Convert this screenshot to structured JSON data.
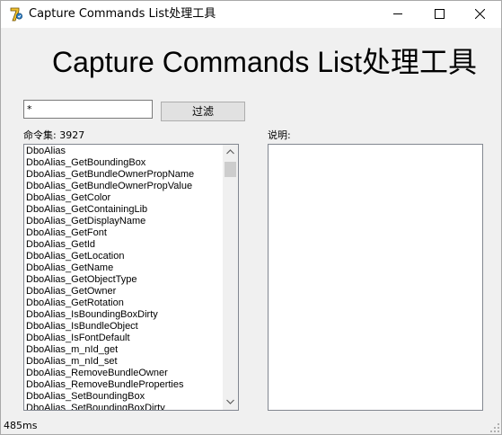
{
  "window": {
    "title": "Capture Commands List处理工具"
  },
  "header": {
    "title": "Capture Commands List处理工具"
  },
  "filter": {
    "value": "*",
    "button_label": "过滤"
  },
  "commands": {
    "label": "命令集: 3927",
    "items": [
      "DboAlias",
      "DboAlias_GetBoundingBox",
      "DboAlias_GetBundleOwnerPropName",
      "DboAlias_GetBundleOwnerPropValue",
      "DboAlias_GetColor",
      "DboAlias_GetContainingLib",
      "DboAlias_GetDisplayName",
      "DboAlias_GetFont",
      "DboAlias_GetId",
      "DboAlias_GetLocation",
      "DboAlias_GetName",
      "DboAlias_GetObjectType",
      "DboAlias_GetOwner",
      "DboAlias_GetRotation",
      "DboAlias_IsBoundingBoxDirty",
      "DboAlias_IsBundleObject",
      "DboAlias_IsFontDefault",
      "DboAlias_m_nId_get",
      "DboAlias_m_nId_set",
      "DboAlias_RemoveBundleOwner",
      "DboAlias_RemoveBundleProperties",
      "DboAlias_SetBoundingBox",
      "DboAlias_SetBoundingBoxDirty"
    ]
  },
  "description": {
    "label": "说明:",
    "text": ""
  },
  "status": {
    "text": "485ms"
  },
  "colors": {
    "window_bg": "#f0f0f0",
    "titlebar_bg": "#ffffff",
    "border": "#828790",
    "button_bg": "#e1e1e1"
  }
}
